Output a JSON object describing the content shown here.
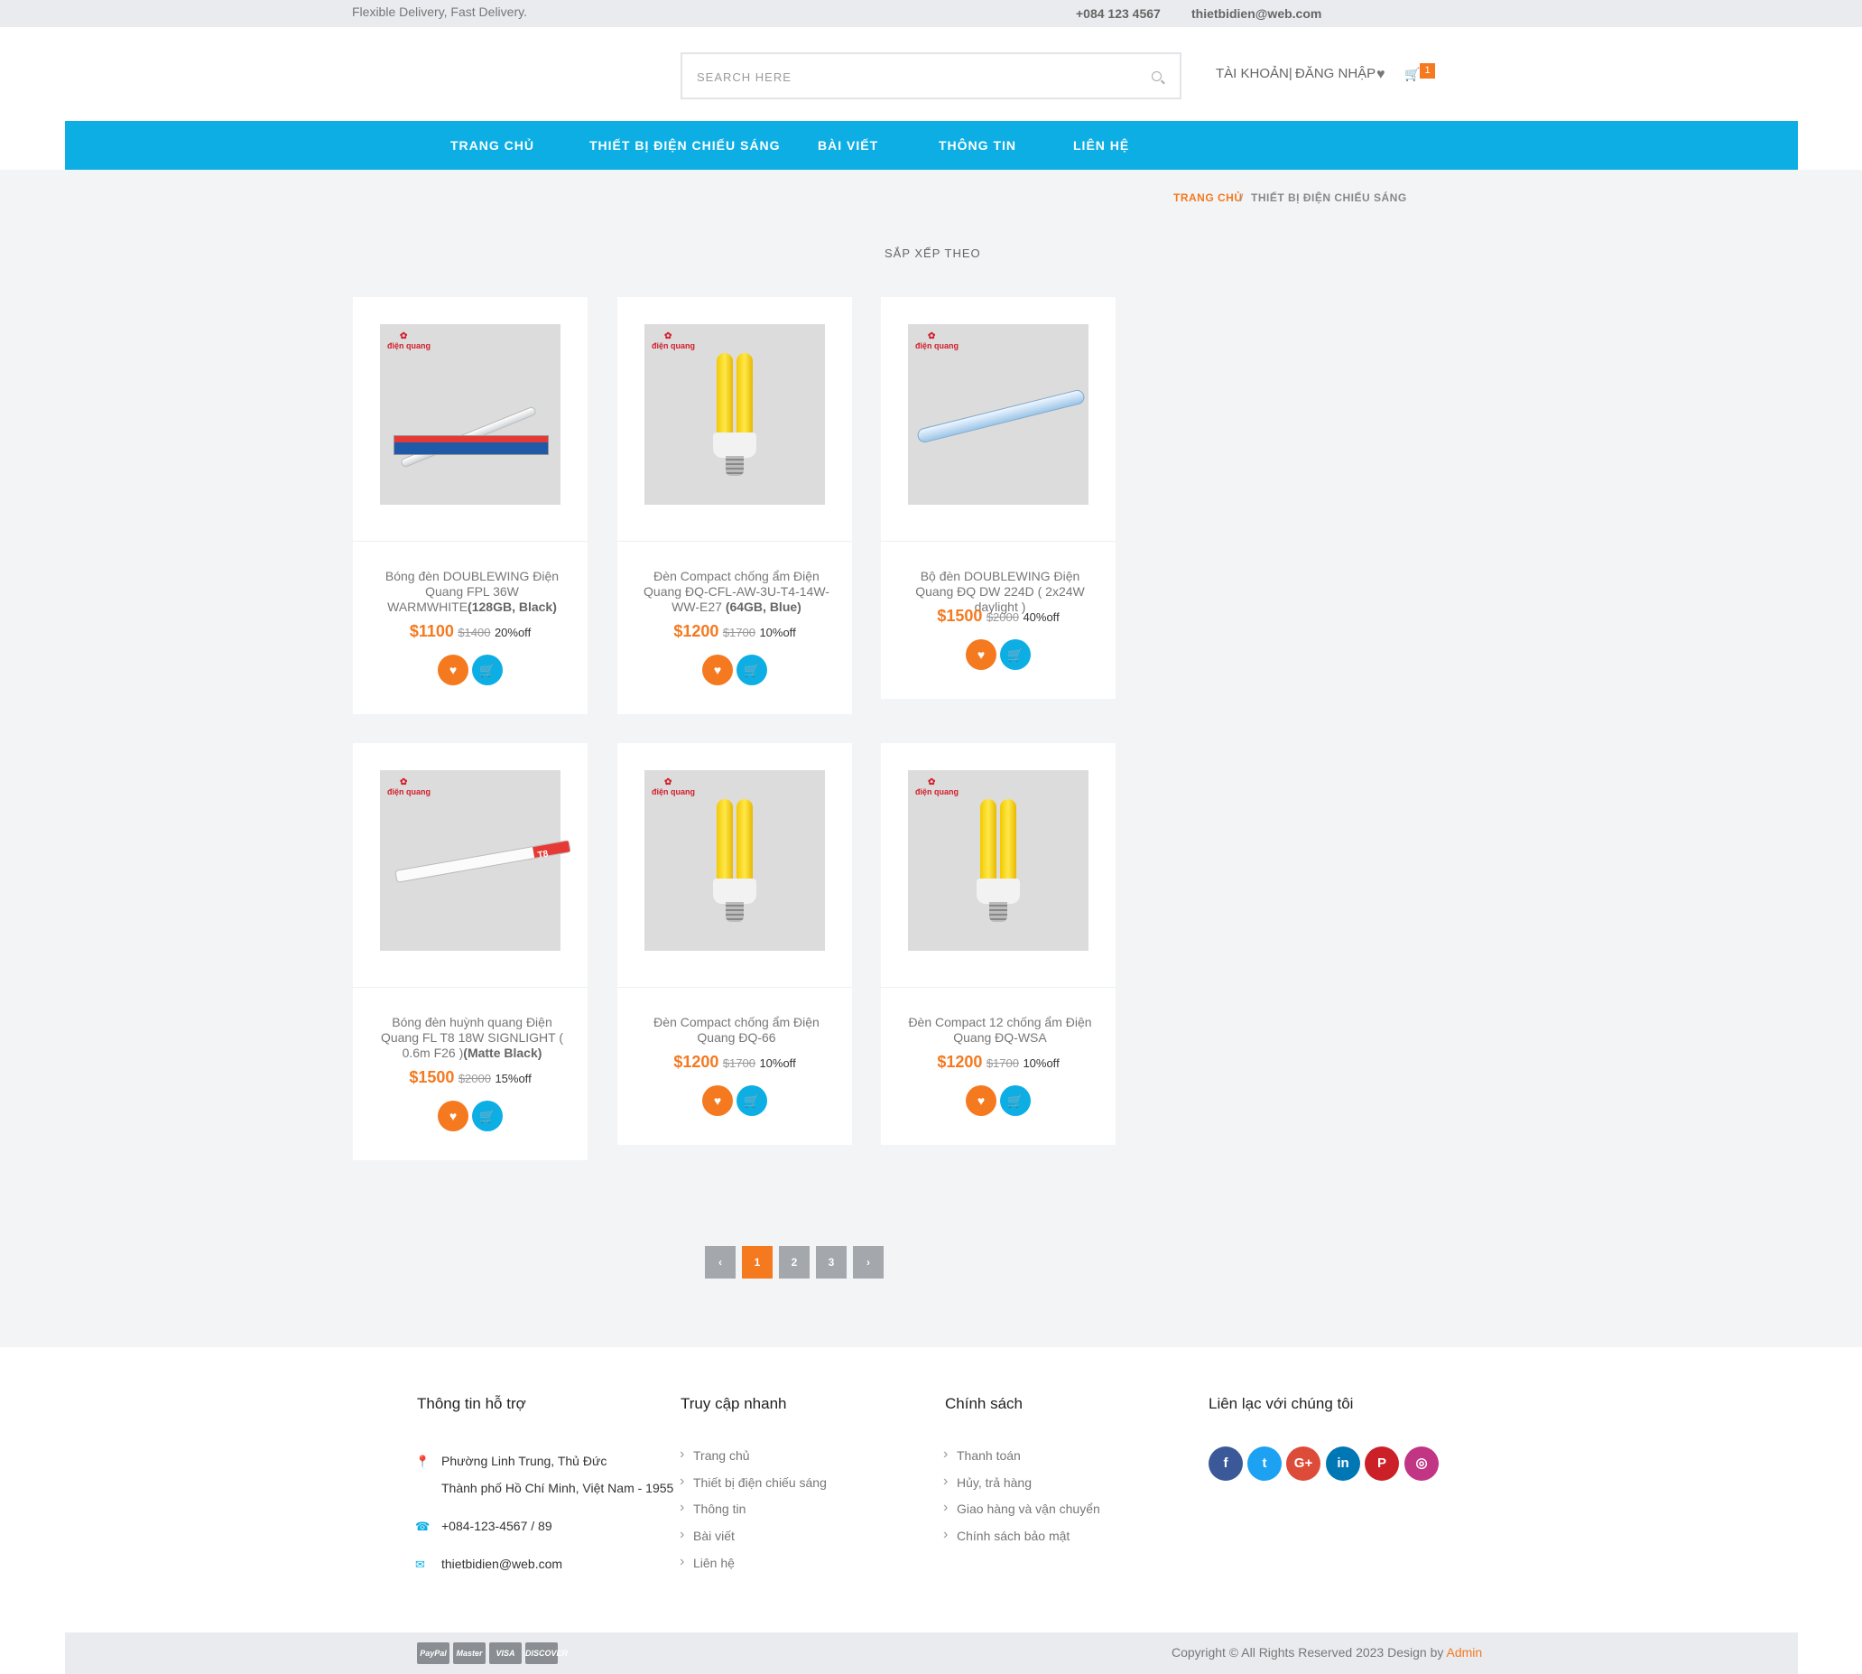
{
  "topbar": {
    "tagline": "Flexible Delivery, Fast Delivery.",
    "phone": "+084 123 4567",
    "email": "thietbidien@web.com"
  },
  "header": {
    "search_placeholder": "SEARCH HERE",
    "account": "TÀI KHOẢN|",
    "login": "ĐĂNG NHẬP",
    "cart_count": "1"
  },
  "nav": {
    "items": [
      "TRANG CHỦ",
      "THIẾT BỊ ĐIỆN CHIẾU SÁNG",
      "BÀI VIẾT",
      "THÔNG TIN",
      "LIÊN HỆ"
    ]
  },
  "breadcrumb": {
    "home": "TRANG CHỦ",
    "separator": "/",
    "current": "THIẾT BỊ ĐIỆN CHIẾU SÁNG"
  },
  "sort_label": "SẮP XẾP THEO",
  "brand_logo": "điện quang",
  "products": [
    {
      "name": "Bóng đèn DOUBLEWING Điện Quang FPL 36W WARMWHITE",
      "variant": "(128GB, Black)",
      "price": "$1100",
      "old_price": "$1400",
      "discount": "20%off",
      "image": "tube-box"
    },
    {
      "name": "Đèn Compact chống ẩm Điện Quang ĐQ-CFL-AW-3U-T4-14W-WW-E27",
      "variant": "(64GB, Blue)",
      "price": "$1200",
      "old_price": "$1700",
      "discount": "10%off",
      "image": "yellow-bulb"
    },
    {
      "name": "Bộ đèn DOUBLEWING Điện Quang ĐQ DW 224D ( 2x24W daylight )",
      "variant": "",
      "price": "$1500",
      "old_price": "$2000",
      "discount": "40%off",
      "image": "fixture"
    },
    {
      "name": "Bóng đèn huỳnh quang Điện Quang FL T8 18W SIGNLIGHT ( 0.6m F26 )",
      "variant": "(Matte Black)",
      "price": "$1500",
      "old_price": "$2000",
      "discount": "15%off",
      "image": "t8-tube"
    },
    {
      "name": "Đèn Compact chống ẩm Điện Quang ĐQ-66",
      "variant": "",
      "price": "$1200",
      "old_price": "$1700",
      "discount": "10%off",
      "image": "yellow-bulb"
    },
    {
      "name": "Đèn Compact 12 chống ẩm Điện Quang ĐQ-WSA",
      "variant": "",
      "price": "$1200",
      "old_price": "$1700",
      "discount": "10%off",
      "image": "yellow-bulb"
    }
  ],
  "t8_label": "T8",
  "pagination": {
    "prev": "‹",
    "pages": [
      "1",
      "2",
      "3"
    ],
    "active": "1",
    "next": "›"
  },
  "footer": {
    "support": {
      "heading": "Thông tin hỗ trợ",
      "address_line1": "Phường Linh Trung, Thủ Đức",
      "address_line2": "Thành phố Hồ Chí Minh, Việt Nam - 1955",
      "phone": "+084-123-4567 / 89",
      "email": "thietbidien@web.com"
    },
    "quick_links": {
      "heading": "Truy cập nhanh",
      "items": [
        "Trang chủ",
        "Thiết bị điện chiếu sáng",
        "Thông tin",
        "Bài viết",
        "Liên hệ"
      ]
    },
    "policy": {
      "heading": "Chính sách",
      "items": [
        "Thanh toán",
        "Hủy, trả hàng",
        "Giao hàng và vận chuyển",
        "Chính sách bảo mật"
      ]
    },
    "contact": {
      "heading": "Liên lạc với chúng tôi",
      "social": [
        {
          "icon": "facebook-icon",
          "glyph": "f",
          "color": "#3b5998"
        },
        {
          "icon": "twitter-icon",
          "glyph": "t",
          "color": "#1da1f2"
        },
        {
          "icon": "google-plus-icon",
          "glyph": "G+",
          "color": "#dd4b39"
        },
        {
          "icon": "linkedin-icon",
          "glyph": "in",
          "color": "#0077b5"
        },
        {
          "icon": "pinterest-icon",
          "glyph": "P",
          "color": "#cb2027"
        },
        {
          "icon": "instagram-icon",
          "glyph": "◎",
          "color": "#c13584"
        }
      ]
    }
  },
  "bottombar": {
    "payments": [
      "PayPal",
      "Master",
      "VISA",
      "DISCOVER"
    ],
    "copyright": "Copyright © All Rights Reserved 2023 Design by",
    "copyright_link": "Admin"
  }
}
